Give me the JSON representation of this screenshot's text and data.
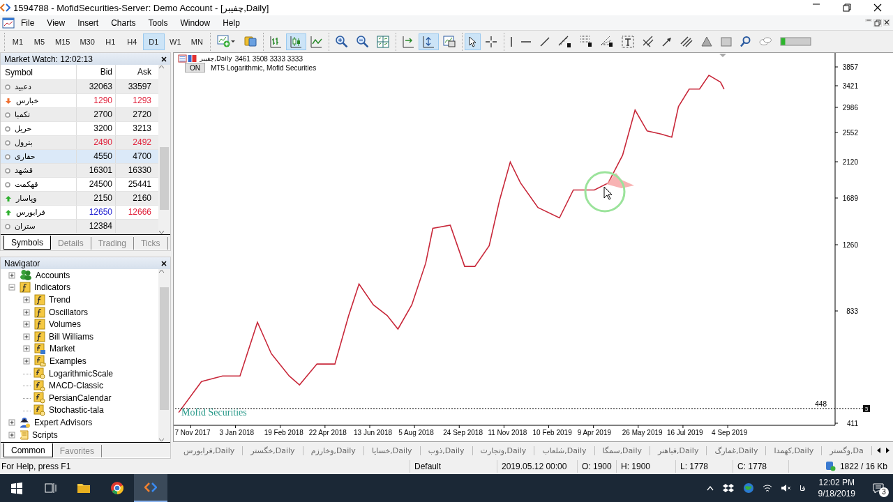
{
  "window": {
    "title": "1594788 - MofidSecurities-Server: Demo Account - [چفیبر,Daily]"
  },
  "menu": [
    "File",
    "View",
    "Insert",
    "Charts",
    "Tools",
    "Window",
    "Help"
  ],
  "toolbar": {
    "timeframes": [
      {
        "label": "M1",
        "selected": false
      },
      {
        "label": "M5",
        "selected": false
      },
      {
        "label": "M15",
        "selected": false
      },
      {
        "label": "M30",
        "selected": false
      },
      {
        "label": "H1",
        "selected": false
      },
      {
        "label": "H4",
        "selected": false
      },
      {
        "label": "D1",
        "selected": true
      },
      {
        "label": "W1",
        "selected": false
      },
      {
        "label": "MN",
        "selected": false
      }
    ],
    "tool_groups": [
      [
        {
          "kind": "new-chart",
          "selected": false
        },
        {
          "kind": "profiles",
          "selected": false
        }
      ],
      [
        {
          "kind": "bar-chart",
          "selected": false
        },
        {
          "kind": "candlesticks",
          "selected": true
        },
        {
          "kind": "line-chart",
          "selected": false
        }
      ],
      [
        {
          "kind": "zoom-in",
          "selected": false
        },
        {
          "kind": "zoom-out",
          "selected": false
        },
        {
          "kind": "tile",
          "selected": false
        }
      ],
      [
        {
          "kind": "auto-scroll",
          "selected": false
        },
        {
          "kind": "chart-shift",
          "selected": true
        },
        {
          "kind": "templates",
          "selected": false
        }
      ],
      [
        {
          "kind": "cursor",
          "selected": true
        },
        {
          "kind": "crosshair",
          "selected": false
        }
      ],
      [
        {
          "kind": "vertical-line",
          "selected": false
        },
        {
          "kind": "horizontal-line",
          "selected": false
        },
        {
          "kind": "trend-line",
          "selected": false
        },
        {
          "kind": "fibo-expansion",
          "selected": false
        },
        {
          "kind": "fibo-retracement",
          "selected": false
        },
        {
          "kind": "fibo-fan",
          "selected": false
        },
        {
          "kind": "text",
          "selected": false
        },
        {
          "kind": "pitchfork",
          "selected": false
        },
        {
          "kind": "arrow",
          "selected": false
        },
        {
          "kind": "channel",
          "selected": false
        },
        {
          "kind": "triangle",
          "selected": false
        },
        {
          "kind": "rectangle",
          "selected": false
        },
        {
          "kind": "search",
          "selected": false
        },
        {
          "kind": "chat",
          "selected": false
        },
        {
          "kind": "connection",
          "selected": false
        }
      ]
    ]
  },
  "market_watch": {
    "title": "Market Watch: 12:02:13",
    "columns": [
      "Symbol",
      "Bid",
      "Ask"
    ],
    "rows": [
      {
        "symbol": "دعبید",
        "up": false,
        "down": false,
        "bid": {
          "value": "32063",
          "color": "#000000"
        },
        "ask": {
          "value": "33597",
          "color": "#000000"
        },
        "selected": false
      },
      {
        "symbol": "خبارس",
        "up": false,
        "down": true,
        "bid": {
          "value": "1290",
          "color": "#e0203a"
        },
        "ask": {
          "value": "1293",
          "color": "#e0203a"
        },
        "selected": false
      },
      {
        "symbol": "تکمبا",
        "up": false,
        "down": false,
        "bid": {
          "value": "2700",
          "color": "#000000"
        },
        "ask": {
          "value": "2720",
          "color": "#000000"
        },
        "selected": false
      },
      {
        "symbol": "حریل",
        "up": false,
        "down": false,
        "bid": {
          "value": "3200",
          "color": "#000000"
        },
        "ask": {
          "value": "3213",
          "color": "#000000"
        },
        "selected": false
      },
      {
        "symbol": "بترول",
        "up": false,
        "down": false,
        "bid": {
          "value": "2490",
          "color": "#e0203a"
        },
        "ask": {
          "value": "2492",
          "color": "#e0203a"
        },
        "selected": false
      },
      {
        "symbol": "حفاری",
        "up": false,
        "down": false,
        "bid": {
          "value": "4550",
          "color": "#000000"
        },
        "ask": {
          "value": "4700",
          "color": "#000000"
        },
        "selected": true
      },
      {
        "symbol": "قشهد",
        "up": false,
        "down": false,
        "bid": {
          "value": "16301",
          "color": "#000000"
        },
        "ask": {
          "value": "16330",
          "color": "#000000"
        },
        "selected": false
      },
      {
        "symbol": "قهکمت",
        "up": false,
        "down": false,
        "bid": {
          "value": "24500",
          "color": "#000000"
        },
        "ask": {
          "value": "25441",
          "color": "#000000"
        },
        "selected": false
      },
      {
        "symbol": "وپاسار",
        "up": true,
        "down": false,
        "bid": {
          "value": "2150",
          "color": "#000000"
        },
        "ask": {
          "value": "2160",
          "color": "#000000"
        },
        "selected": false
      },
      {
        "symbol": "فرابورس",
        "up": true,
        "down": false,
        "bid": {
          "value": "12650",
          "color": "#1a1ad0"
        },
        "ask": {
          "value": "12666",
          "color": "#e0203a"
        },
        "selected": false
      },
      {
        "symbol": "ستران",
        "up": false,
        "down": false,
        "bid": {
          "value": "12384",
          "color": "#000000"
        },
        "selected": false
      }
    ],
    "tabs": [
      {
        "label": "Symbols",
        "selected": true
      },
      {
        "label": "Details",
        "selected": false
      },
      {
        "label": "Trading",
        "selected": false
      },
      {
        "label": "Ticks",
        "selected": false
      }
    ]
  },
  "navigator": {
    "title": "Navigator",
    "tree": [
      {
        "label": "Accounts",
        "kind": "accounts",
        "expanded": false
      },
      {
        "label": "Indicators",
        "kind": "indicator-folder",
        "expanded": true,
        "children": [
          {
            "label": "Trend",
            "kind": "indicator-folder",
            "expanded": false
          },
          {
            "label": "Oscillators",
            "kind": "indicator-folder",
            "expanded": false
          },
          {
            "label": "Volumes",
            "kind": "indicator-folder",
            "expanded": false
          },
          {
            "label": "Bill Williams",
            "kind": "indicator-folder",
            "expanded": false
          },
          {
            "label": "Market",
            "kind": "market",
            "expanded": false
          },
          {
            "label": "Examples",
            "kind": "examples",
            "expanded": false
          },
          {
            "label": "LogarithmicScale",
            "kind": "indicator"
          },
          {
            "label": "MACD-Classic",
            "kind": "indicator"
          },
          {
            "label": "PersianCalendar",
            "kind": "indicator"
          },
          {
            "label": "Stochastic-tala",
            "kind": "indicator"
          }
        ]
      },
      {
        "label": "Expert Advisors",
        "kind": "experts",
        "expanded": false
      },
      {
        "label": "Scripts",
        "kind": "scripts",
        "expanded": false
      }
    ],
    "tabs": [
      {
        "label": "Common",
        "selected": true
      },
      {
        "label": "Favorites",
        "selected": false
      }
    ]
  },
  "chart": {
    "symbol_label": "چفیبر,Daily",
    "ohlc": "3461 3508 3333 3333",
    "indicator_button": "ON",
    "indicator_label": "MT5 Logarithmic, Mofid Securities",
    "broker_label": "Mofid Securities",
    "price_labels": [
      "3857",
      "3421",
      "2986",
      "2552",
      "2120",
      "1689",
      "1260",
      "833",
      "411"
    ],
    "date_labels": [
      "7 Nov 2017",
      "3 Jan 2018",
      "19 Feb 2018",
      "22 Apr 2018",
      "13 Jun 2018",
      "5 Aug 2018",
      "24 Sep 2018",
      "11 Nov 2018",
      "10 Feb 2019",
      "9 Apr 2019",
      "26 May 2019",
      "16 Jul 2019",
      "4 Sep 2019"
    ],
    "price_line": {
      "label": "448",
      "marker": "3"
    }
  },
  "chart_tabs": [
    "فرابورس,Daily",
    "خگستر,Daily",
    "وخارزم,Daily",
    "خسایا,Daily",
    "ذوب,Daily",
    "وتجارت,Daily",
    "شلعاب,Daily",
    "سمگا,Daily",
    "فباهنر,Daily",
    "غمارگ,Daily",
    "کهمدا,Daily",
    "وگستر,Da"
  ],
  "status_bar": {
    "help": "For Help, press F1",
    "profile": "Default",
    "time": "2019.05.12 00:00",
    "open": "O: 1900",
    "high": "H: 1900",
    "low": "L: 1778",
    "close": "C: 1778",
    "traffic": "1822 / 16 Kb"
  },
  "taskbar": {
    "language": "فا",
    "time": "12:02 PM",
    "date": "9/18/2019",
    "notifications": "3"
  }
}
